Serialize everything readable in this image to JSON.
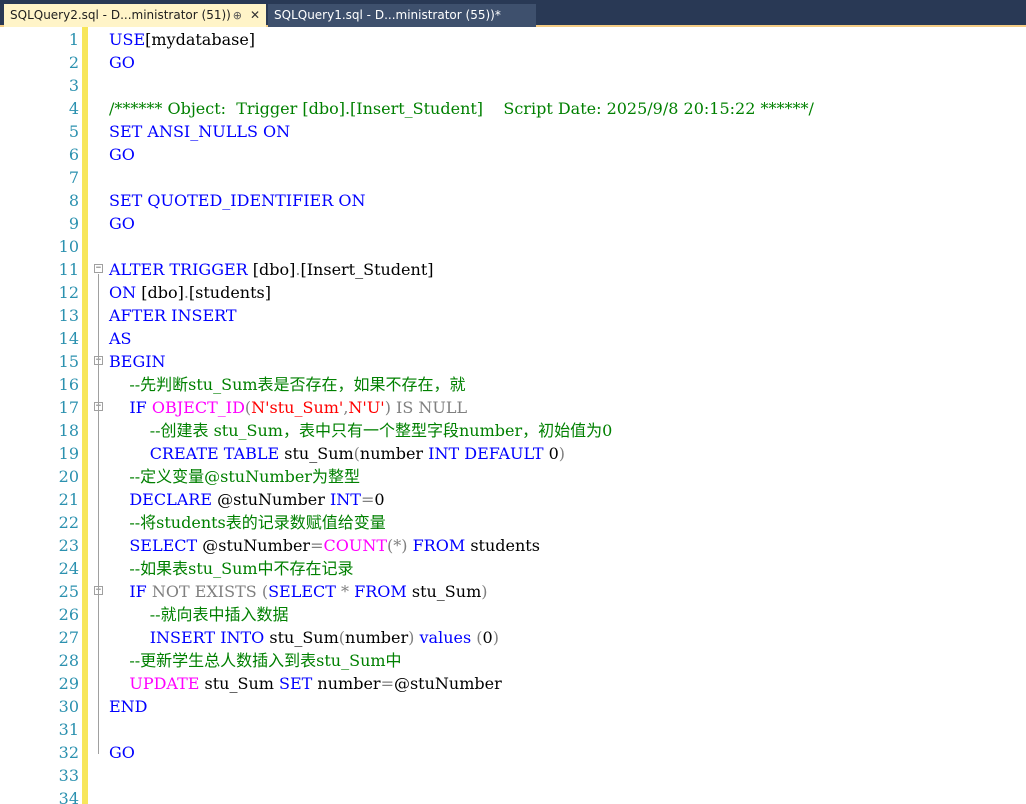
{
  "tabs": [
    {
      "label": "SQLQuery2.sql - D...ministrator (51))",
      "active": true,
      "pin": "⊕",
      "close": "✕"
    },
    {
      "label": "SQLQuery1.sql - D...ministrator (55))*",
      "active": false
    }
  ],
  "colors": {
    "keyword": "#0000ff",
    "comment": "#008000",
    "function": "#ff00ff",
    "operator": "#808080",
    "string": "#ff0000",
    "line_number": "#2b91af",
    "tab_bar": "#293955",
    "active_tab": "#fff4c8",
    "change_bar": "#f7e65a"
  },
  "lines": [
    {
      "n": "1",
      "segs": [
        [
          "kw",
          "USE"
        ],
        [
          "",
          "[mydatabase]"
        ]
      ]
    },
    {
      "n": "2",
      "segs": [
        [
          "kw",
          "GO"
        ]
      ]
    },
    {
      "n": "3",
      "segs": []
    },
    {
      "n": "4",
      "segs": [
        [
          "cm",
          "/****** Object:  Trigger [dbo].[Insert_Student]    Script Date: 2025/9/8 20:15:22 ******/"
        ]
      ]
    },
    {
      "n": "5",
      "segs": [
        [
          "kw",
          "SET"
        ],
        [
          "",
          " "
        ],
        [
          "kw",
          "ANSI_NULLS"
        ],
        [
          "",
          " "
        ],
        [
          "kw",
          "ON"
        ]
      ]
    },
    {
      "n": "6",
      "segs": [
        [
          "kw",
          "GO"
        ]
      ]
    },
    {
      "n": "7",
      "segs": []
    },
    {
      "n": "8",
      "segs": [
        [
          "kw",
          "SET"
        ],
        [
          "",
          " "
        ],
        [
          "kw",
          "QUOTED_IDENTIFIER"
        ],
        [
          "",
          " "
        ],
        [
          "kw",
          "ON"
        ]
      ]
    },
    {
      "n": "9",
      "segs": [
        [
          "kw",
          "GO"
        ]
      ]
    },
    {
      "n": "10",
      "segs": []
    },
    {
      "n": "11",
      "fold": "box",
      "segs": [
        [
          "kw",
          "ALTER"
        ],
        [
          "",
          " "
        ],
        [
          "kw",
          "TRIGGER"
        ],
        [
          "",
          " [dbo]"
        ],
        [
          "gr",
          "."
        ],
        [
          "",
          "[Insert_Student]"
        ]
      ]
    },
    {
      "n": "12",
      "segs": [
        [
          "kw",
          "ON"
        ],
        [
          "",
          " [dbo]"
        ],
        [
          "gr",
          "."
        ],
        [
          "",
          "[students]"
        ]
      ]
    },
    {
      "n": "13",
      "segs": [
        [
          "kw",
          "AFTER"
        ],
        [
          "",
          " "
        ],
        [
          "kw",
          "INSERT"
        ]
      ]
    },
    {
      "n": "14",
      "segs": [
        [
          "kw",
          "AS"
        ]
      ]
    },
    {
      "n": "15",
      "fold": "box",
      "segs": [
        [
          "kw",
          "BEGIN"
        ]
      ]
    },
    {
      "n": "16",
      "segs": [
        [
          "",
          "    "
        ],
        [
          "cm",
          "--先判断stu_Sum表是否存在，如果不存在，就"
        ]
      ]
    },
    {
      "n": "17",
      "fold": "box-inner",
      "segs": [
        [
          "",
          "    "
        ],
        [
          "kw",
          "IF"
        ],
        [
          "",
          " "
        ],
        [
          "fn",
          "OBJECT_ID"
        ],
        [
          "gr",
          "("
        ],
        [
          "st",
          "N'stu_Sum'"
        ],
        [
          "gr",
          ","
        ],
        [
          "st",
          "N'U'"
        ],
        [
          "gr",
          ")"
        ],
        [
          "",
          " "
        ],
        [
          "gr",
          "IS NULL"
        ]
      ]
    },
    {
      "n": "18",
      "segs": [
        [
          "",
          "        "
        ],
        [
          "cm",
          "--创建表 stu_Sum，表中只有一个整型字段number，初始值为0"
        ]
      ]
    },
    {
      "n": "19",
      "segs": [
        [
          "",
          "        "
        ],
        [
          "kw",
          "CREATE"
        ],
        [
          "",
          " "
        ],
        [
          "kw",
          "TABLE"
        ],
        [
          "",
          " stu_Sum"
        ],
        [
          "gr",
          "("
        ],
        [
          "",
          "number "
        ],
        [
          "kw",
          "INT"
        ],
        [
          "",
          " "
        ],
        [
          "kw",
          "DEFAULT"
        ],
        [
          "",
          " 0"
        ],
        [
          "gr",
          ")"
        ]
      ]
    },
    {
      "n": "20",
      "segs": [
        [
          "",
          "    "
        ],
        [
          "cm",
          "--定义变量@stuNumber为整型"
        ]
      ]
    },
    {
      "n": "21",
      "segs": [
        [
          "",
          "    "
        ],
        [
          "kw",
          "DECLARE"
        ],
        [
          "",
          " @stuNumber "
        ],
        [
          "kw",
          "INT"
        ],
        [
          "gr",
          "="
        ],
        [
          "",
          "0"
        ]
      ]
    },
    {
      "n": "22",
      "segs": [
        [
          "",
          "    "
        ],
        [
          "cm",
          "--将students表的记录数赋值给变量"
        ]
      ]
    },
    {
      "n": "23",
      "segs": [
        [
          "",
          "    "
        ],
        [
          "kw",
          "SELECT"
        ],
        [
          "",
          " @stuNumber"
        ],
        [
          "gr",
          "="
        ],
        [
          "fn",
          "COUNT"
        ],
        [
          "gr",
          "(*)"
        ],
        [
          "",
          " "
        ],
        [
          "kw",
          "FROM"
        ],
        [
          "",
          " students"
        ]
      ]
    },
    {
      "n": "24",
      "segs": [
        [
          "",
          "    "
        ],
        [
          "cm",
          "--如果表stu_Sum中不存在记录"
        ]
      ]
    },
    {
      "n": "25",
      "fold": "box-inner",
      "segs": [
        [
          "",
          "    "
        ],
        [
          "kw",
          "IF"
        ],
        [
          "",
          " "
        ],
        [
          "gr",
          "NOT EXISTS"
        ],
        [
          "",
          " "
        ],
        [
          "gr",
          "("
        ],
        [
          "kw",
          "SELECT"
        ],
        [
          "",
          " "
        ],
        [
          "gr",
          "*"
        ],
        [
          "",
          " "
        ],
        [
          "kw",
          "FROM"
        ],
        [
          "",
          " stu_Sum"
        ],
        [
          "gr",
          ")"
        ]
      ]
    },
    {
      "n": "26",
      "segs": [
        [
          "",
          "        "
        ],
        [
          "cm",
          "--就向表中插入数据"
        ]
      ]
    },
    {
      "n": "27",
      "segs": [
        [
          "",
          "        "
        ],
        [
          "kw",
          "INSERT"
        ],
        [
          "",
          " "
        ],
        [
          "kw",
          "INTO"
        ],
        [
          "",
          " stu_Sum"
        ],
        [
          "gr",
          "("
        ],
        [
          "",
          "number"
        ],
        [
          "gr",
          ")"
        ],
        [
          "",
          " "
        ],
        [
          "kw",
          "values"
        ],
        [
          "",
          " "
        ],
        [
          "gr",
          "("
        ],
        [
          "",
          "0"
        ],
        [
          "gr",
          ")"
        ]
      ]
    },
    {
      "n": "28",
      "segs": [
        [
          "",
          "    "
        ],
        [
          "cm",
          "--更新学生总人数插入到表stu_Sum中"
        ]
      ]
    },
    {
      "n": "29",
      "segs": [
        [
          "",
          "    "
        ],
        [
          "fn",
          "UPDATE"
        ],
        [
          "",
          " stu_Sum "
        ],
        [
          "kw",
          "SET"
        ],
        [
          "",
          " number"
        ],
        [
          "gr",
          "="
        ],
        [
          "",
          "@stuNumber"
        ]
      ]
    },
    {
      "n": "30",
      "segs": [
        [
          "kw",
          "END"
        ]
      ]
    },
    {
      "n": "31",
      "segs": []
    },
    {
      "n": "32",
      "segs": [
        [
          "kw",
          "GO"
        ]
      ]
    },
    {
      "n": "33",
      "segs": []
    },
    {
      "n": "34",
      "segs": []
    }
  ]
}
